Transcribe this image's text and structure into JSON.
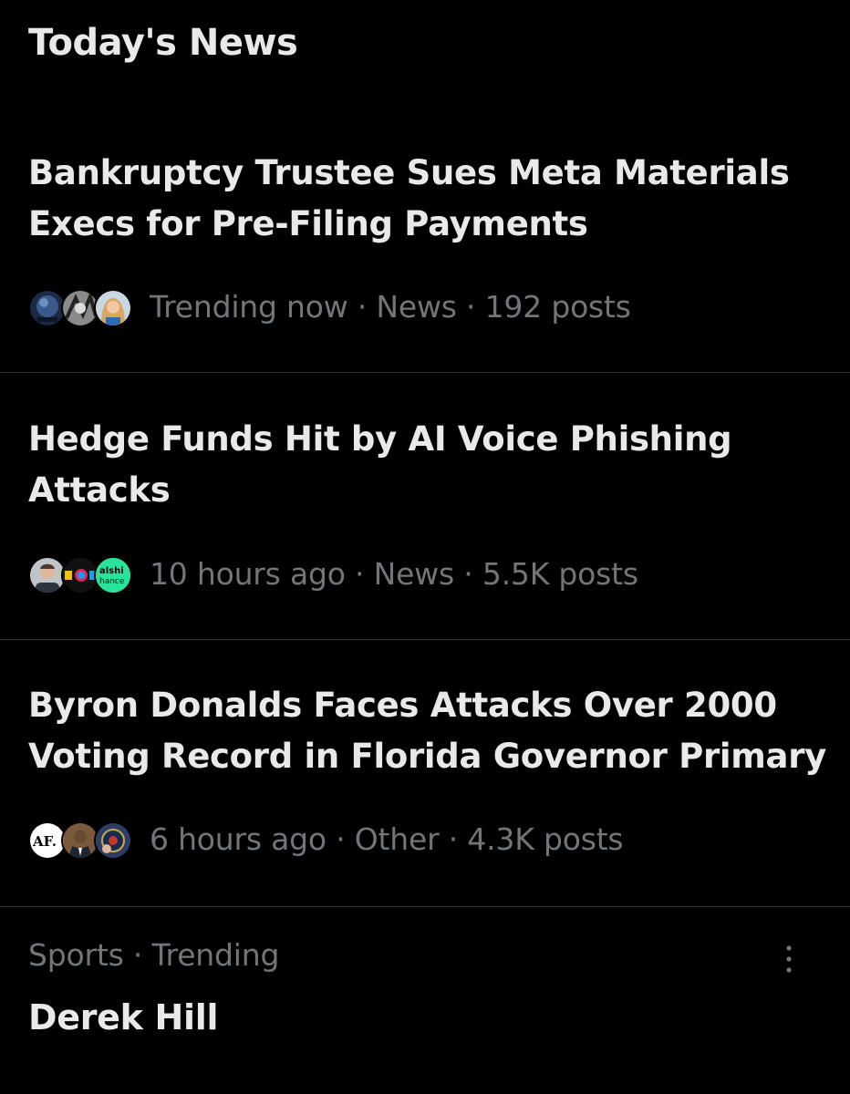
{
  "section": {
    "title": "Today's News"
  },
  "stories": [
    {
      "headline": "Bankruptcy Trustee Sues Meta Materials Execs for Pre-Filing Payments",
      "meta": "Trending now · News · 192 posts",
      "avatars": [
        "avatar-earth-photo",
        "avatar-grayscale-art",
        "avatar-woman-photo"
      ]
    },
    {
      "headline": "Hedge Funds Hit by AI Voice Phishing Attacks",
      "meta": "10 hours ago · News · 5.5K posts",
      "avatars": [
        "avatar-man-photo",
        "avatar-colorful-logo",
        "avatar-kalshi-logo"
      ],
      "avatar_logo_text": {
        "line1": "alshi",
        "line2": "hance"
      }
    },
    {
      "headline": "Byron Donalds Faces Attacks Over 2000 Voting Record in Florida Governor Primary",
      "meta": "6 hours ago · Other · 4.3K posts",
      "avatars": [
        "avatar-af-logo",
        "avatar-man-suit-photo",
        "avatar-seal-photo"
      ],
      "avatar_logo_text": {
        "line1": "AF."
      }
    }
  ],
  "trend": {
    "context": "Sports · Trending",
    "name": "Derek Hill",
    "more_icon": "more-vertical-icon"
  },
  "colors": {
    "background": "#000000",
    "primary_text": "#e7e9ea",
    "secondary_text": "#71767b",
    "divider": "#2f3336"
  }
}
